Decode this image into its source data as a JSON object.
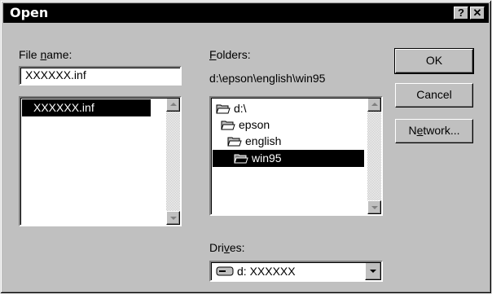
{
  "window": {
    "title": "Open",
    "help_btn": "?",
    "close_btn": "✕"
  },
  "file_name": {
    "label_pre": "File ",
    "label_u": "n",
    "label_post": "ame:",
    "value": "XXXXXX.inf",
    "list": [
      "XXXXXX.inf"
    ]
  },
  "folders": {
    "label_u": "F",
    "label_post": "olders:",
    "path": "d:\\epson\\english\\win95",
    "items": [
      "d:\\",
      "epson",
      "english",
      "win95"
    ]
  },
  "drives": {
    "label_pre": "Dri",
    "label_u": "v",
    "label_post": "es:",
    "value": "d: XXXXXX"
  },
  "buttons": {
    "ok": "OK",
    "cancel": "Cancel",
    "network_pre": "N",
    "network_u": "e",
    "network_post": "twork..."
  }
}
